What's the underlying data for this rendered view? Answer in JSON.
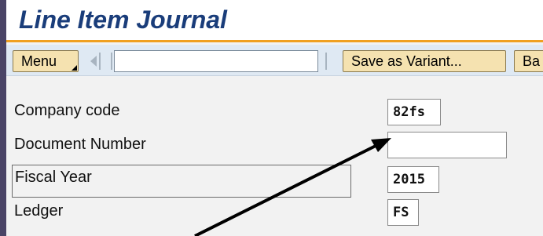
{
  "title": "Line Item Journal",
  "toolbar": {
    "menu_label": "Menu",
    "command_field_value": "",
    "save_variant_label": "Save as Variant...",
    "back_label": "Ba"
  },
  "form": {
    "company_code": {
      "label": "Company code",
      "value": "82fs"
    },
    "document_number": {
      "label": "Document Number",
      "value": ""
    },
    "fiscal_year": {
      "label": "Fiscal Year",
      "value": "2015"
    },
    "ledger": {
      "label": "Ledger",
      "value": "FS"
    }
  },
  "colors": {
    "title_text": "#1a3d7a",
    "accent_line": "#f0a020",
    "toolbar_bg": "#dfe9f3",
    "button_bg": "#f5e2b0",
    "frame_bg": "#4a4466"
  },
  "icons": [
    "arrow-left-icon",
    "menu-corner-icon",
    "annotation-arrow-icon"
  ]
}
